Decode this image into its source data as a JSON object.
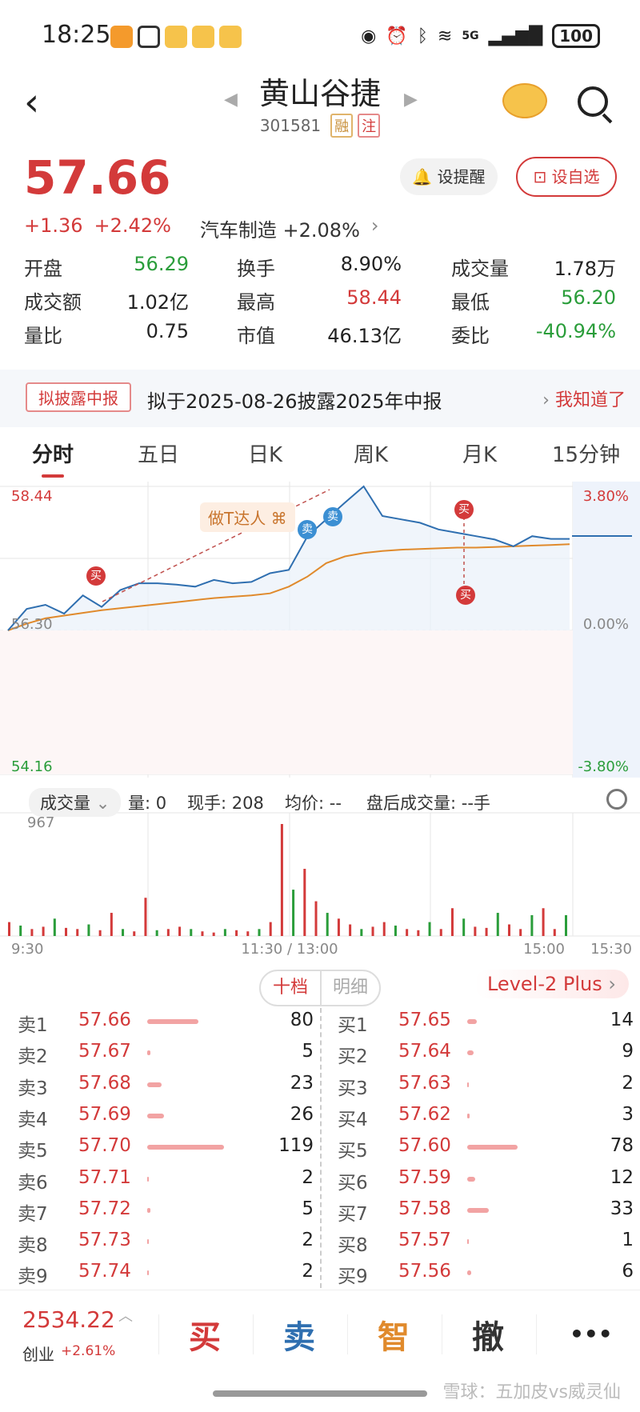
{
  "status_bar": {
    "time": "18:25",
    "network": "5G",
    "battery": "100"
  },
  "header": {
    "title": "黄山谷捷",
    "code": "301581",
    "tag_rong": "融",
    "tag_zhu": "注"
  },
  "quote": {
    "price": "57.66",
    "change": "+1.36",
    "change_pct": "+2.42%",
    "sector": "汽车制造 +2.08%",
    "alert_button": "设提醒",
    "watch_button": "设自选"
  },
  "stats": [
    {
      "label": "开盘",
      "value": "56.29",
      "color": "green"
    },
    {
      "label": "换手",
      "value": "8.90%",
      "color": "black"
    },
    {
      "label": "成交量",
      "value": "1.78万",
      "color": "black"
    },
    {
      "label": "成交额",
      "value": "1.02亿",
      "color": "black"
    },
    {
      "label": "最高",
      "value": "58.44",
      "color": "red"
    },
    {
      "label": "最低",
      "value": "56.20",
      "color": "green"
    },
    {
      "label": "量比",
      "value": "0.75",
      "color": "black"
    },
    {
      "label": "市值",
      "value": "46.13亿",
      "color": "black"
    },
    {
      "label": "委比",
      "value": "-40.94%",
      "color": "green"
    }
  ],
  "notice": {
    "tag": "拟披露中报",
    "text": "拟于2025-08-26披露2025年中报",
    "ack": "我知道了"
  },
  "tabs": [
    "分时",
    "五日",
    "日K",
    "周K",
    "月K",
    "15分钟"
  ],
  "chart": {
    "price_high": "58.44",
    "price_mid": "56.30",
    "price_low": "54.16",
    "pct_high": "3.80%",
    "pct_mid": "0.00%",
    "pct_low": "-3.80%",
    "badge": "做T达人",
    "buy_label": "买",
    "sell_label": "卖",
    "vol_max": "967",
    "time_labels": [
      "9:30",
      "11:30 / 13:00",
      "15:00",
      "15:30"
    ]
  },
  "chart_data": {
    "type": "line",
    "series": [
      {
        "values": [
          56.3,
          56.62,
          56.68,
          56.55,
          56.82,
          56.65,
          56.9,
          57.0,
          57.0,
          56.98,
          56.95,
          57.05,
          57.0,
          57.02,
          57.15,
          57.2,
          57.7,
          57.95,
          58.2,
          58.44,
          58.0,
          57.95,
          57.9,
          57.8,
          57.75,
          57.7,
          57.65,
          57.55,
          57.7,
          57.66,
          57.66
        ]
      },
      {
        "values": [
          56.3,
          56.4,
          56.48,
          56.52,
          56.56,
          56.6,
          56.63,
          56.66,
          56.69,
          56.72,
          56.75,
          56.78,
          56.8,
          56.82,
          56.85,
          56.95,
          57.1,
          57.3,
          57.4,
          57.45,
          57.48,
          57.5,
          57.51,
          57.52,
          57.53,
          57.53,
          57.54,
          57.55,
          57.56,
          57.57,
          57.58
        ]
      }
    ],
    "ylim": [
      54.16,
      58.44
    ],
    "volume": [
      120,
      90,
      60,
      80,
      150,
      70,
      60,
      100,
      50,
      200,
      60,
      40,
      330,
      50,
      60,
      80,
      60,
      40,
      30,
      60,
      50,
      40,
      60,
      120,
      967,
      400,
      580,
      300,
      200,
      150,
      100,
      60,
      80,
      120,
      90,
      60,
      50,
      120,
      60,
      240,
      150,
      80,
      70,
      200,
      100,
      60,
      180,
      240,
      60,
      180
    ]
  },
  "volume_header": {
    "dropdown": "成交量",
    "items": [
      "量: 0",
      "现手: 208",
      "均价: --",
      "盘后成交量: --手"
    ]
  },
  "orderbook": {
    "tab_ten": "十档",
    "tab_detail": "明细",
    "level2": "Level-2 Plus",
    "sell": [
      {
        "label": "卖1",
        "price": "57.66",
        "qty": "80",
        "fill": 0.67
      },
      {
        "label": "卖2",
        "price": "57.67",
        "qty": "5",
        "fill": 0.04
      },
      {
        "label": "卖3",
        "price": "57.68",
        "qty": "23",
        "fill": 0.19
      },
      {
        "label": "卖4",
        "price": "57.69",
        "qty": "26",
        "fill": 0.22
      },
      {
        "label": "卖5",
        "price": "57.70",
        "qty": "119",
        "fill": 1.0
      },
      {
        "label": "卖6",
        "price": "57.71",
        "qty": "2",
        "fill": 0.02
      },
      {
        "label": "卖7",
        "price": "57.72",
        "qty": "5",
        "fill": 0.04
      },
      {
        "label": "卖8",
        "price": "57.73",
        "qty": "2",
        "fill": 0.02
      },
      {
        "label": "卖9",
        "price": "57.74",
        "qty": "2",
        "fill": 0.02
      }
    ],
    "buy": [
      {
        "label": "买1",
        "price": "57.65",
        "qty": "14",
        "fill": 0.12
      },
      {
        "label": "买2",
        "price": "57.64",
        "qty": "9",
        "fill": 0.08
      },
      {
        "label": "买3",
        "price": "57.63",
        "qty": "2",
        "fill": 0.02
      },
      {
        "label": "买4",
        "price": "57.62",
        "qty": "3",
        "fill": 0.03
      },
      {
        "label": "买5",
        "price": "57.60",
        "qty": "78",
        "fill": 0.66
      },
      {
        "label": "买6",
        "price": "57.59",
        "qty": "12",
        "fill": 0.1
      },
      {
        "label": "买7",
        "price": "57.58",
        "qty": "33",
        "fill": 0.28
      },
      {
        "label": "买8",
        "price": "57.57",
        "qty": "1",
        "fill": 0.01
      },
      {
        "label": "买9",
        "price": "57.56",
        "qty": "6",
        "fill": 0.05
      }
    ]
  },
  "bottom_bar": {
    "index_value": "2534.22",
    "index_name": "创业",
    "index_change": "+2.61%",
    "buy": "买",
    "sell": "卖",
    "smart": "智",
    "cancel": "撤",
    "more": "•••"
  },
  "watermark": "雪球：五加皮vs威灵仙",
  "colors": {
    "up": "#d33a3a",
    "down": "#2a9d3a",
    "line": "#2f6fb0",
    "avg": "#e08a2c"
  }
}
